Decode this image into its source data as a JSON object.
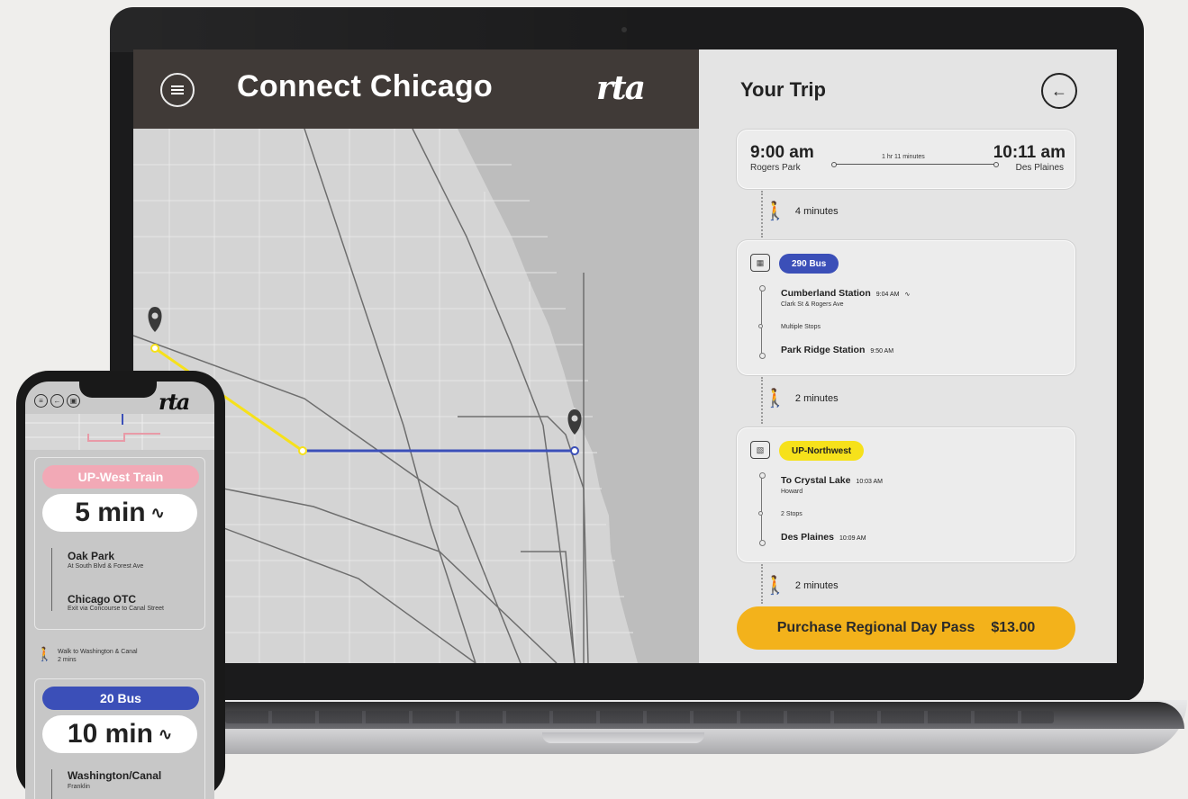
{
  "app": {
    "title": "Connect Chicago",
    "logo_text": "rta"
  },
  "map": {
    "origin_marker": "map-pin-icon",
    "destination_marker": "map-pin-icon",
    "route_colors": {
      "yellow": "#f6e11b",
      "blue": "#3b4fb8"
    }
  },
  "trip": {
    "title": "Your Trip",
    "back_icon": "arrow-left-icon",
    "summary": {
      "depart_time": "9:00 am",
      "depart_place": "Rogers Park",
      "duration": "1 hr 11 minutes",
      "arrive_time": "10:11 am",
      "arrive_place": "Des Plaines"
    },
    "walk1": "4 minutes",
    "leg1": {
      "mode": "290 Bus",
      "mode_color": "#3b4fb8",
      "start_stop": "Cumberland Station",
      "start_time": "9:04 AM",
      "start_sub": "Clark St & Rogers Ave",
      "middle": "Multiple Stops",
      "end_stop": "Park Ridge Station",
      "end_time": "9:50 AM"
    },
    "walk2": "2 minutes",
    "leg2": {
      "mode": "UP-Northwest",
      "mode_color": "#f6e11b",
      "start_stop": "To Crystal Lake",
      "start_time": "10:03 AM",
      "start_sub": "Howard",
      "middle": "2 Stops",
      "end_stop": "Des Plaines",
      "end_time": "10:09 AM"
    },
    "walk3": "2 minutes",
    "purchase": {
      "label": "Purchase Regional Day Pass",
      "price": "$13.00",
      "color": "#f3b21b"
    }
  },
  "phone": {
    "logo_text": "rta",
    "card1": {
      "line": "UP-West Train",
      "line_color": "#f2a9b6",
      "eta": "5 min",
      "stop1": "Oak Park",
      "stop1_sub": "At South Blvd & Forest Ave",
      "stop2": "Chicago OTC",
      "stop2_sub": "Exit via Concourse to Canal Street"
    },
    "walk": "Walk to Washington & Canal\n2 mins",
    "card2": {
      "line": "20 Bus",
      "line_color": "#3b4fb8",
      "eta": "10 min",
      "stop1": "Washington/Canal",
      "stop1_sub": "Franklin"
    }
  }
}
